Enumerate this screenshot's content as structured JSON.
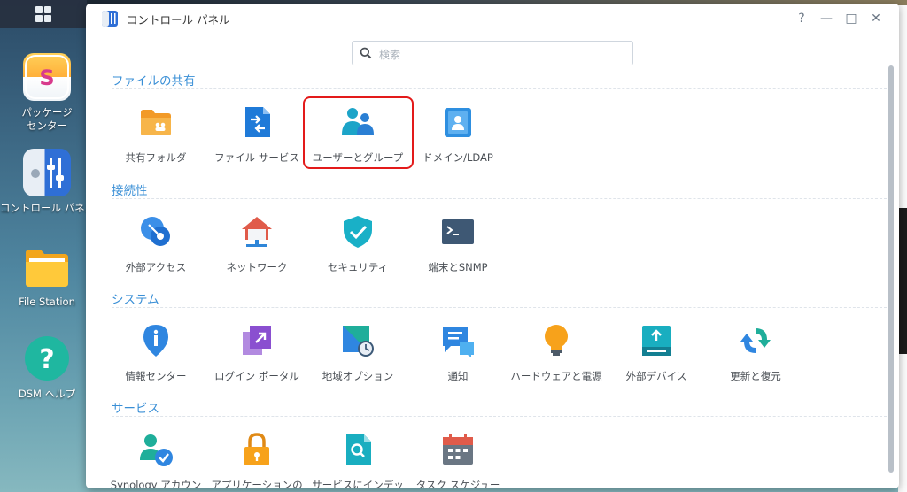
{
  "desktop": {
    "icons": [
      {
        "label_line1": "パッケージ",
        "label_line2": "センター"
      },
      {
        "label_line1": "コントロール パネル",
        "label_line2": ""
      },
      {
        "label_line1": "File Station",
        "label_line2": ""
      },
      {
        "label_line1": "DSM ヘルプ",
        "label_line2": ""
      }
    ]
  },
  "window": {
    "title": "コントロール パネル",
    "controls": {
      "help": "?",
      "minimize": "—",
      "maximize": "□",
      "close": "✕"
    },
    "search_placeholder": "検索",
    "sections": [
      {
        "title": "ファイルの共有",
        "items": [
          {
            "label": "共有フォルダ",
            "icon": "shared-folder-icon"
          },
          {
            "label": "ファイル サービス",
            "icon": "file-services-icon"
          },
          {
            "label": "ユーザーとグループ",
            "icon": "user-group-icon",
            "highlighted": true
          },
          {
            "label": "ドメイン/LDAP",
            "icon": "domain-ldap-icon"
          }
        ]
      },
      {
        "title": "接続性",
        "items": [
          {
            "label": "外部アクセス",
            "icon": "external-access-icon"
          },
          {
            "label": "ネットワーク",
            "icon": "network-icon"
          },
          {
            "label": "セキュリティ",
            "icon": "security-shield-icon"
          },
          {
            "label": "端末とSNMP",
            "icon": "terminal-snmp-icon"
          }
        ]
      },
      {
        "title": "システム",
        "items": [
          {
            "label": "情報センター",
            "icon": "info-center-icon"
          },
          {
            "label": "ログイン ポータル",
            "icon": "login-portal-icon"
          },
          {
            "label": "地域オプション",
            "icon": "regional-options-icon"
          },
          {
            "label": "通知",
            "icon": "notification-icon"
          },
          {
            "label": "ハードウェアと電源",
            "icon": "hardware-power-icon"
          },
          {
            "label": "外部デバイス",
            "icon": "external-devices-icon"
          },
          {
            "label": "更新と復元",
            "icon": "update-restore-icon"
          }
        ]
      },
      {
        "title": "サービス",
        "items": [
          {
            "label": "Synology アカウン",
            "icon": "synology-account-icon"
          },
          {
            "label": "アプリケーションの",
            "icon": "application-privileges-icon"
          },
          {
            "label": "サービスにインデッ",
            "icon": "indexing-service-icon"
          },
          {
            "label": "タスク スケジュー",
            "icon": "task-scheduler-icon"
          }
        ]
      }
    ]
  },
  "colors": {
    "section_title": "#3a8fd6",
    "highlight_border": "#e31a1a"
  }
}
